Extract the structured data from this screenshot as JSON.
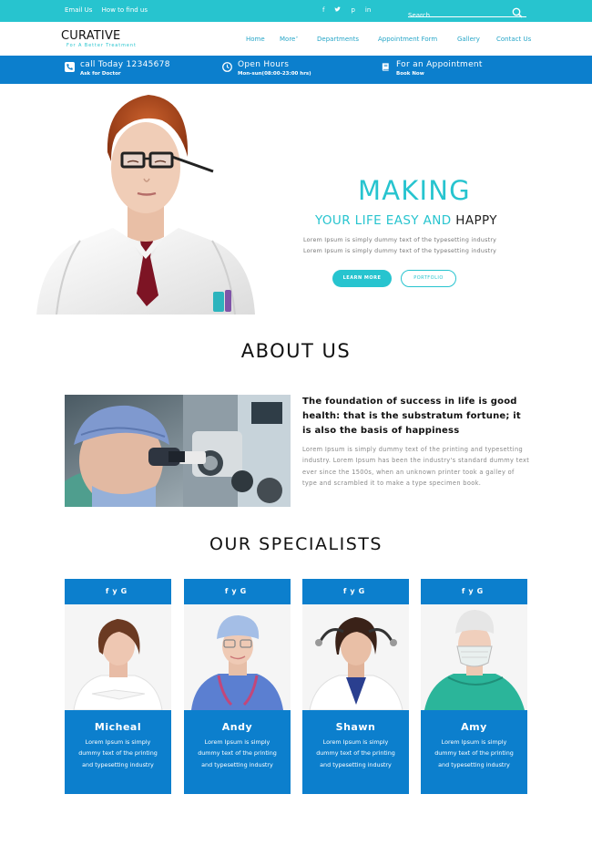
{
  "topbar": {
    "links": [
      "Email Us",
      "How to find us"
    ],
    "social_icons": [
      "facebook-icon",
      "twitter-icon",
      "pinterest-icon",
      "linkedin-icon"
    ],
    "search_placeholder": "Search...",
    "color": "#27c4cf"
  },
  "header": {
    "logo_name": "CURATIVE",
    "logo_tagline": "For A Better Treatment",
    "nav": [
      "Home",
      "More",
      "Departments",
      "Appointment Form",
      "Gallery",
      "Contact Us"
    ]
  },
  "infobar": {
    "color": "#0c7fcd",
    "items": [
      {
        "icon": "phone-icon",
        "title": "call Today 12345678",
        "sub": "Ask for Doctor"
      },
      {
        "icon": "clock-icon",
        "title": "Open Hours",
        "sub": "Mon-sun(08:00-23:00 hrs)"
      },
      {
        "icon": "book-icon",
        "title": "For an Appointment",
        "sub": "Book Now"
      }
    ]
  },
  "hero": {
    "heading": "MAKING",
    "subheading_prefix": "YOUR LIFE EASY AND",
    "subheading_highlight": "HAPPY",
    "lines": [
      "Lorem Ipsum is simply dummy text of the typesetting industry",
      "Lorem Ipsum is simply dummy text of the typesetting industry"
    ],
    "button_primary": "LEARN MORE",
    "button_secondary": "PORTFOLIO"
  },
  "about": {
    "title": "ABOUT US",
    "heading": "The foundation of success in life is good health: that is the substratum fortune; it is also the basis of happiness",
    "body": "Lorem Ipsum is simply dummy text of the printing and typesetting industry. Lorem Ipsum has been the industry's standard dummy text ever since the 1500s, when an unknown printer took a galley of type and scrambled it to make a type specimen book."
  },
  "specialists": {
    "title": "OUR SPECIALISTS",
    "card_icons": "f  G",
    "cards": [
      {
        "name": "Micheal",
        "desc": "Lorem Ipsum is simply dummy text of the printing and typesetting industry"
      },
      {
        "name": "Andy",
        "desc": "Lorem Ipsum is simply dummy text of the printing and typesetting industry"
      },
      {
        "name": "Shawn",
        "desc": "Lorem Ipsum is simply dummy text of the printing and typesetting industry"
      },
      {
        "name": "Amy",
        "desc": "Lorem Ipsum is simply dummy text of the printing and typesetting industry"
      }
    ]
  },
  "colors": {
    "teal": "#27c4cf",
    "blue": "#0c7fcd"
  }
}
